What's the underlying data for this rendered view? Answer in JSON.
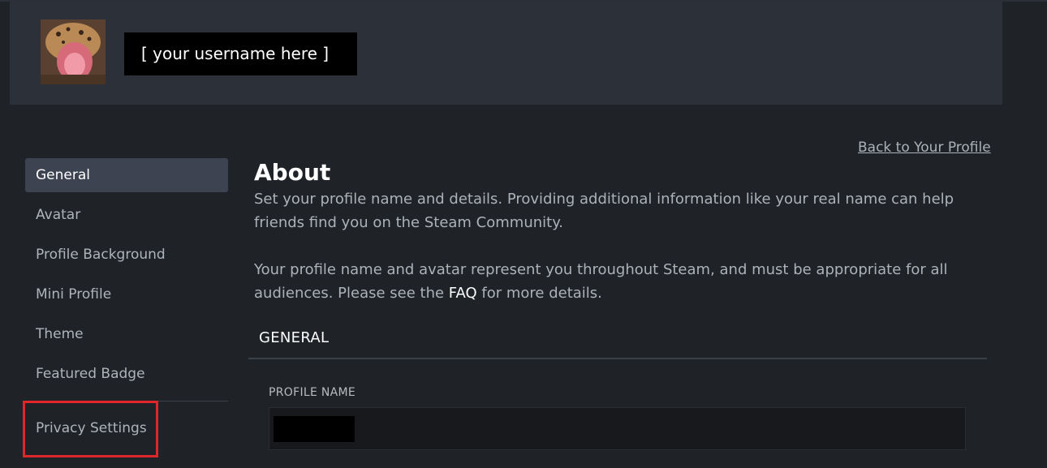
{
  "header": {
    "username": "[ your username here ]"
  },
  "nav": {
    "back_link": "Back to Your Profile"
  },
  "sidebar": {
    "items": [
      {
        "label": "General",
        "active": true
      },
      {
        "label": "Avatar"
      },
      {
        "label": "Profile Background"
      },
      {
        "label": "Mini Profile"
      },
      {
        "label": "Theme"
      },
      {
        "label": "Featured Badge"
      }
    ],
    "privacy": {
      "label": "Privacy Settings"
    }
  },
  "main": {
    "title": "About",
    "para1": "Set your profile name and details. Providing additional information like your real name can help friends find you on the Steam Community.",
    "para2_before": "Your profile name and avatar represent you throughout Steam, and must be appropriate for all audiences. Please see the ",
    "para2_link": "FAQ",
    "para2_after": " for more details.",
    "section_title": "GENERAL",
    "profile_name_label": "PROFILE NAME",
    "profile_name_value": ""
  },
  "colors": {
    "background": "#1f2227",
    "header": "#2c3039",
    "active_item": "#3d4350",
    "highlight": "#e0262b"
  }
}
